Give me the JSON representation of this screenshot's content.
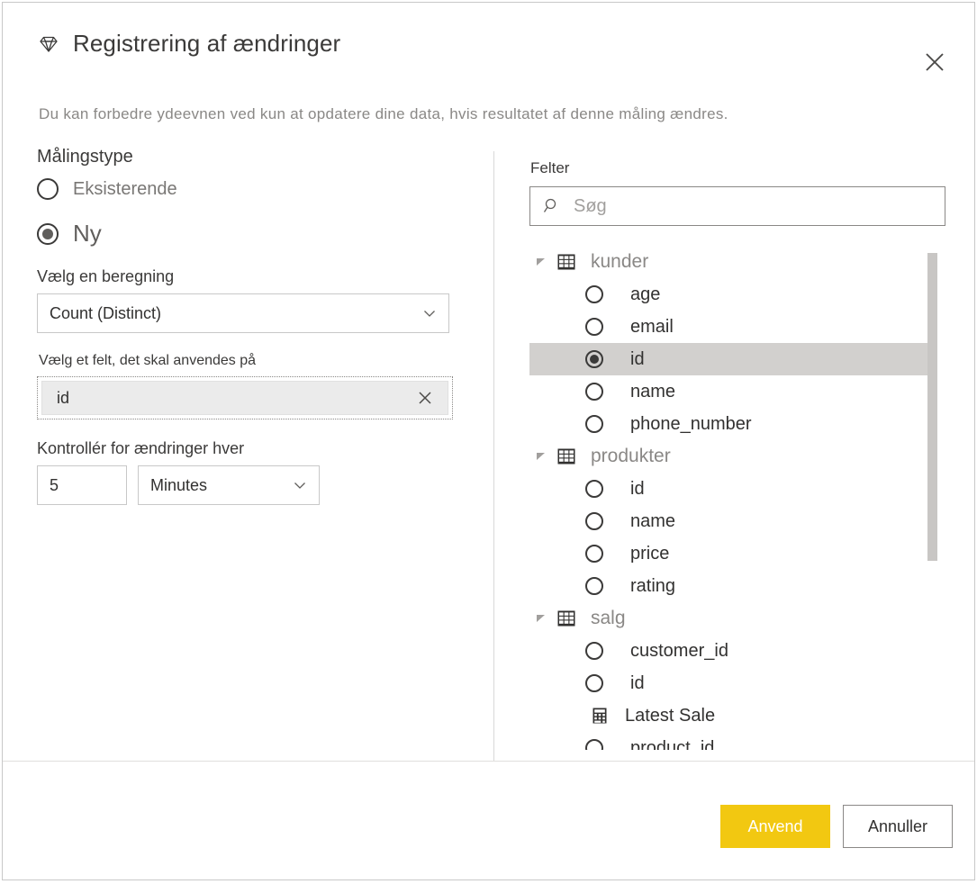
{
  "dialog": {
    "title": "Registrering af ændringer",
    "title_icon": "gem-icon",
    "close_icon": "close-icon",
    "description": "Du kan forbedre ydeevnen ved kun at opdatere dine data, hvis resultatet af denne måling ændres."
  },
  "left": {
    "measure_type": {
      "label": "Målingstype",
      "options": [
        {
          "label": "Eksisterende",
          "selected": false
        },
        {
          "label": "Ny",
          "selected": true
        }
      ]
    },
    "calculation": {
      "label": "Vælg en beregning",
      "value": "Count (Distinct)",
      "chevron_icon": "chevron-down-icon"
    },
    "field": {
      "label": "Vælg et felt, det skal anvendes på",
      "value": "id",
      "clear_icon": "close-icon"
    },
    "interval": {
      "label": "Kontrollér for ændringer hver",
      "amount": "5",
      "unit": "Minutes",
      "chevron_icon": "chevron-down-icon"
    }
  },
  "right": {
    "label": "Felter",
    "search": {
      "placeholder": "Søg",
      "value": "",
      "icon": "search-icon"
    },
    "tree": [
      {
        "name": "kunder",
        "icon": "table-icon",
        "expanded": true,
        "twisty_icon": "triangle-expanded-icon",
        "fields": [
          {
            "name": "age",
            "type": "column",
            "selected": false
          },
          {
            "name": "email",
            "type": "column",
            "selected": false
          },
          {
            "name": "id",
            "type": "column",
            "selected": true
          },
          {
            "name": "name",
            "type": "column",
            "selected": false
          },
          {
            "name": "phone_number",
            "type": "column",
            "selected": false
          }
        ]
      },
      {
        "name": "produkter",
        "icon": "table-icon",
        "expanded": true,
        "twisty_icon": "triangle-expanded-icon",
        "fields": [
          {
            "name": "id",
            "type": "column",
            "selected": false
          },
          {
            "name": "name",
            "type": "column",
            "selected": false
          },
          {
            "name": "price",
            "type": "column",
            "selected": false
          },
          {
            "name": "rating",
            "type": "column",
            "selected": false
          }
        ]
      },
      {
        "name": "salg",
        "icon": "table-icon",
        "expanded": true,
        "twisty_icon": "triangle-expanded-icon",
        "fields": [
          {
            "name": "customer_id",
            "type": "column",
            "selected": false
          },
          {
            "name": "id",
            "type": "column",
            "selected": false
          },
          {
            "name": "Latest Sale",
            "type": "measure",
            "selected": false
          },
          {
            "name": "product_id",
            "type": "column",
            "selected": false
          }
        ]
      }
    ]
  },
  "footer": {
    "apply_label": "Anvend",
    "cancel_label": "Annuller",
    "apply_color": "#f2c811"
  }
}
